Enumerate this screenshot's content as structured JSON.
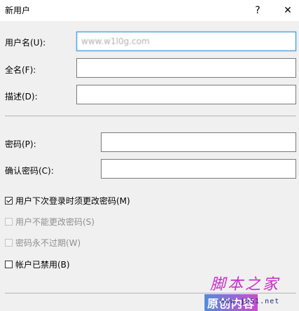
{
  "window": {
    "title": "新用户",
    "help_glyph": "?",
    "close_glyph": "✕"
  },
  "form": {
    "username_label": "用户名(U):",
    "username_value": "www.w1l0g.com",
    "fullname_label": "全名(F):",
    "fullname_value": "",
    "description_label": "描述(D):",
    "description_value": "",
    "password_label": "密码(P):",
    "password_value": "",
    "confirm_label": "确认密码(C):",
    "confirm_value": ""
  },
  "options": [
    {
      "label": "用户下次登录时须更改密码(M)",
      "checked": true,
      "disabled": false
    },
    {
      "label": "用户不能更改密码(S)",
      "checked": false,
      "disabled": true
    },
    {
      "label": "密码永不过期(W)",
      "checked": false,
      "disabled": true
    },
    {
      "label": "帐户已禁用(B)",
      "checked": false,
      "disabled": false
    }
  ],
  "watermark": {
    "top": "脚本之家",
    "bottom": "原创内容",
    "site": "www.jb51.net"
  }
}
